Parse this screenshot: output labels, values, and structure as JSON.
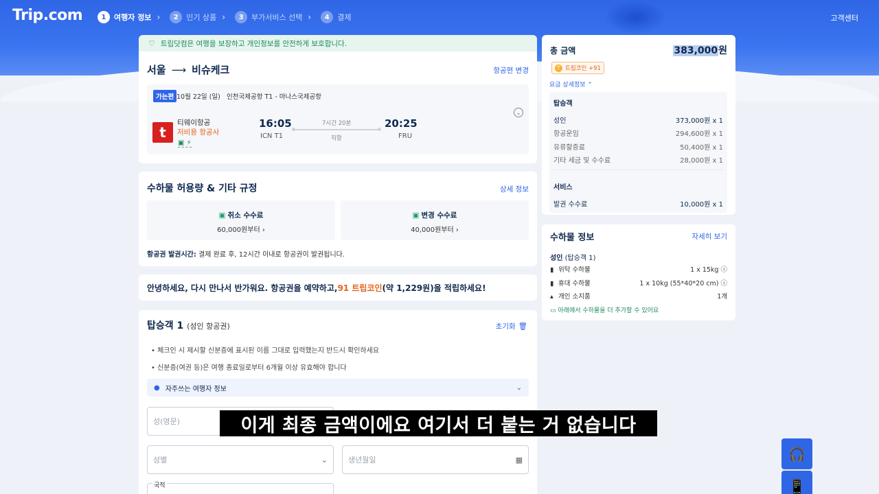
{
  "header": {
    "logo": "Trip.com",
    "steps": [
      {
        "num": "1",
        "label": "여행자 정보"
      },
      {
        "num": "2",
        "label": "인기 상품"
      },
      {
        "num": "3",
        "label": "부가서비스 선택"
      },
      {
        "num": "4",
        "label": "결제"
      }
    ],
    "support": "고객센터"
  },
  "notice": "트립닷컴은 여행을 보장하고 개인정보를 안전하게 보호합니다.",
  "flight": {
    "from": "서울",
    "to": "비슈케크",
    "change": "항공편 변경",
    "badge": "가는편",
    "date": "10월 22일 (일)",
    "airports": "인천국제공항 T1 - 마나스국제공항",
    "airline": "티웨이항공",
    "airline_type": "저비용 항공사",
    "dep_time": "16:05",
    "dep_airport": "ICN T1",
    "duration": "7시간 20분",
    "stops": "직항",
    "arr_time": "20:25",
    "arr_airport": "FRU"
  },
  "baggage_rules": {
    "title": "수하물 허용량 & 기타 규정",
    "detail": "상세 정보",
    "cancel_title": "취소 수수료",
    "cancel_value": "60,000원부터 ›",
    "change_title": "변경 수수료",
    "change_value": "40,000원부터 ›",
    "ticketing_label": "항공권 발권시간:",
    "ticketing_text": " 결제 완료 후, 12시간 이내로 항공권이 발권됩니다."
  },
  "promo": {
    "pre": "안녕하세요, 다시 만나서 반가워요. 항공권을 예약하고, ",
    "coin": "91 트립코인",
    "post": " (약 1,229원)을 적립하세요!"
  },
  "passenger": {
    "title": "탑승객 1",
    "subtitle": "(성인 항공권)",
    "reset": "초기화",
    "notes": [
      "• 체크인 시 제시할 신분증에 표시된 이름 그대로 입력했는지 반드시 확인하세요",
      "• 신분증(여권 등)은 여행 종료일로부터 6개월 이상 유효해야 합니다"
    ],
    "frequent": "자주쓰는 여행자 정보",
    "surname_placeholder": "성(영문)",
    "gender_placeholder": "성별",
    "birth_placeholder": "생년월일",
    "nationality_label": "국적"
  },
  "summary": {
    "total_label": "총 금액",
    "total_value": "383,000",
    "total_unit": "원",
    "coin_badge": "트립코인 +91",
    "fare_detail": "요금 상세정보",
    "pax_head": "탑승객",
    "rows": [
      {
        "label": "성인",
        "value": "373,000원 x 1"
      },
      {
        "label": "항공운임",
        "value": "294,600원 x 1"
      },
      {
        "label": "유류할증료",
        "value": "50,400원 x 1"
      },
      {
        "label": "기타 세금 및 수수료",
        "value": "28,000원 x 1"
      }
    ],
    "service_head": "서비스",
    "service_row": {
      "label": "발권 수수료",
      "value": "10,000원 x 1"
    }
  },
  "baggage_info": {
    "title": "수하물 정보",
    "link": "자세히 보기",
    "sub_bold": "성인",
    "sub_rest": " (탑승객 1)",
    "rows": [
      {
        "label": "위탁 수하물",
        "value": "1 x 15kg"
      },
      {
        "label": "휴대 수하물",
        "value": "1 x 10kg (55*40*20 cm)"
      },
      {
        "label": "개인 소지품",
        "value": "1개"
      }
    ],
    "add": "아래에서 수하물을 더 추가할 수 있어요"
  },
  "subtitle": "이게 최종 금액이에요 여기서 더 붙는 거 없습니다",
  "colors": {
    "primary": "#2f66e6",
    "orange": "#e5651a",
    "green": "#1b8a5a"
  }
}
